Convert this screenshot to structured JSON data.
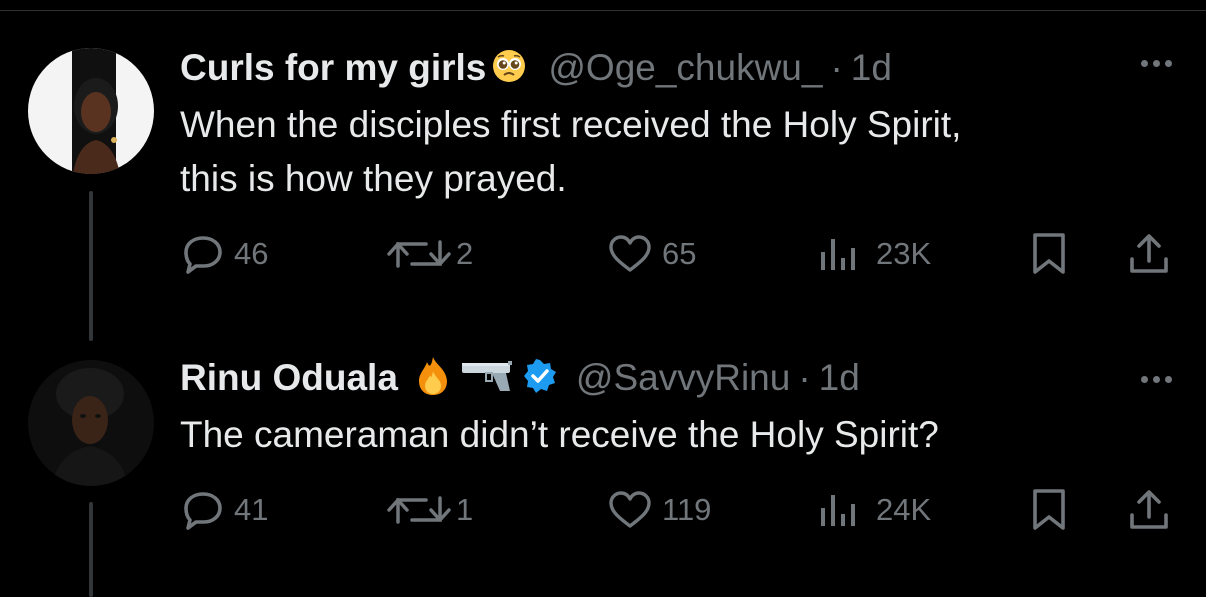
{
  "tweets": [
    {
      "display_name": "Curls for my girls",
      "name_emojis": [
        "pleading-face-emoji"
      ],
      "verified": false,
      "handle": "@Oge_chukwu_",
      "separator": "·",
      "time": "1d",
      "text_lines": [
        "When the disciples first received the Holy Spirit,",
        "this is how they prayed."
      ],
      "stats": {
        "replies": "46",
        "reposts": "2",
        "likes": "65",
        "views": "23K"
      }
    },
    {
      "display_name": "Rinu Oduala",
      "name_emojis": [
        "fire-emoji",
        "pistol-emoji"
      ],
      "verified": true,
      "handle": "@SavvyRinu",
      "separator": "·",
      "time": "1d",
      "text_lines": [
        "The cameraman didn’t receive the Holy Spirit?"
      ],
      "stats": {
        "replies": "41",
        "reposts": "1",
        "likes": "119",
        "views": "24K"
      }
    }
  ],
  "colors": {
    "background": "#000000",
    "primary_text": "#e7e9ea",
    "secondary_text": "#71767b",
    "thread_line": "#333639",
    "verified_badge": "#1d9bf0"
  }
}
